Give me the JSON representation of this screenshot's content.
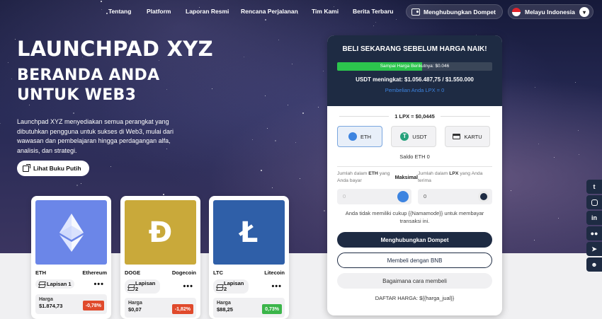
{
  "nav": {
    "links": [
      "Tentang",
      "Platform",
      "Laporan Resmi",
      "Rencana Perjalanan",
      "Tim Kami",
      "Berita Terbaru"
    ],
    "connect_wallet": "Menghubungkan Dompet",
    "language": "Melayu Indonesia"
  },
  "hero": {
    "title": "LAUNCHPAD XYZ",
    "subtitle_1": "BERANDA ANDA",
    "subtitle_2": "UNTUK WEB3",
    "description": "Launchpad XYZ menyediakan semua perangkat yang dibutuhkan pengguna untuk sukses di Web3, mulai dari wawasan dan pembelajaran hingga perdagangan alfa, analisis, dan strategi.",
    "whitepaper_button": "Lihat Buku Putih"
  },
  "coins": [
    {
      "symbol": "ETH",
      "name": "Ethereum",
      "layer": "Lapisan 1",
      "price_label": "Harga",
      "price": "$1.874,73",
      "change": "-0,78%",
      "change_color": "#e04a2c",
      "image_color": "#6b86e8",
      "glyph": ""
    },
    {
      "symbol": "DOGE",
      "name": "Dogecoin",
      "layer": "Lapisan 2",
      "price_label": "Harga",
      "price": "$0,07",
      "change": "-1,82%",
      "change_color": "#e04a2c",
      "image_color": "#c9a93a",
      "glyph": "Đ"
    },
    {
      "symbol": "LTC",
      "name": "Litecoin",
      "layer": "Lapisan 2",
      "price_label": "Harga",
      "price": "$88,25",
      "change": "0,73%",
      "change_color": "#3bb54a",
      "image_color": "#2f5fa8",
      "glyph": "Ł"
    }
  ],
  "panel": {
    "title": "BELI SEKARANG SEBELUM HARGA NAIK!",
    "progress_text": "Sampai Harga Berikutnya: $0.046",
    "progress_fraction": 0.55,
    "usdt_raised": "USDT meningkat: $1.056.487,75 / $1.550.000",
    "lpx_bought": "Pembelian Anda LPX = 0",
    "rate": "1 LPX = $0,0445",
    "pay_options": [
      "ETH",
      "USDT",
      "KARTU"
    ],
    "balance": "Saldo ETH 0",
    "amount_pay_label_a": "Jumlah dalam ",
    "amount_pay_label_b": "ETH",
    "amount_pay_label_c": " yang Anda bayar",
    "max_label": "Maksimal",
    "amount_receive_label_a": "Jumlah dalam ",
    "amount_receive_label_b": "LPX",
    "amount_receive_label_c": " yang Anda terima",
    "pay_value": "0",
    "receive_value": "0",
    "warning": "Anda tidak memiliki cukup {{Namamode}} untuk membayar transaksi ini.",
    "connect_button": "Menghubungkan Dompet",
    "bnb_button": "Membeli dengan BNB",
    "howto_button": "Bagaimana cara membeli",
    "price_list": "DAFTAR HARGA: ${{harga_jual}}"
  },
  "social_icons": [
    "twitter-icon",
    "instagram-icon",
    "linkedin-icon",
    "medium-icon",
    "telegram-icon",
    "discord-icon"
  ],
  "colors": {
    "accent": "#1e2b43",
    "progress": "#2cc44d",
    "link_blue": "#3d84e0"
  }
}
